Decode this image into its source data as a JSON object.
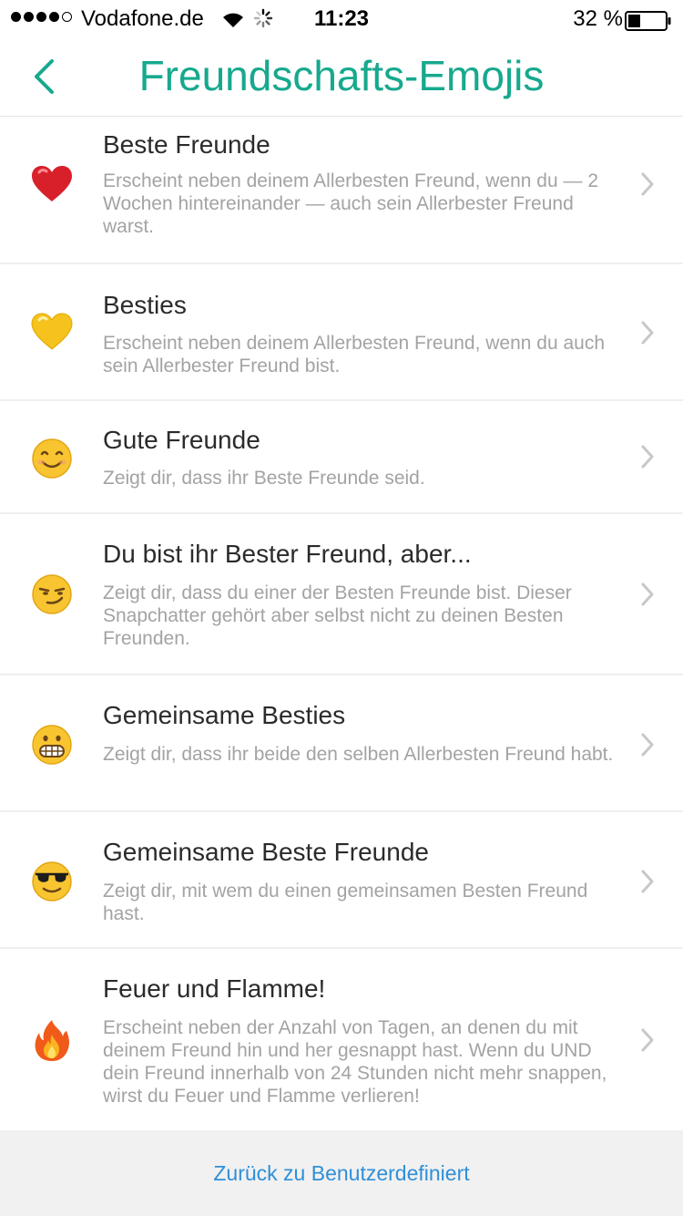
{
  "status_bar": {
    "carrier": "Vodafone.de",
    "time": "11:23",
    "battery": "32 %",
    "signal_bars_filled": 4,
    "signal_bars_total": 5
  },
  "nav": {
    "title": "Freundschafts-Emojis",
    "back_icon": "chevron-left-icon",
    "accent_color": "#16a98e"
  },
  "items": [
    {
      "emoji_name": "red-heart",
      "title": "Beste Freunde",
      "description": "Erscheint neben deinem Allerbesten Freund, wenn du — 2 Wochen hintereinander — auch sein Allerbester Freund warst."
    },
    {
      "emoji_name": "yellow-heart",
      "title": "Besties",
      "description": "Erscheint neben deinem Allerbesten Freund, wenn du auch sein Allerbester Freund bist."
    },
    {
      "emoji_name": "smiling-face",
      "title": "Gute Freunde",
      "description": "Zeigt dir, dass ihr Beste Freunde seid."
    },
    {
      "emoji_name": "smirking-face",
      "title": "Du bist ihr Bester Freund, aber...",
      "description": "Zeigt dir, dass du einer der Besten Freunde bist. Dieser Snapchatter gehört aber selbst nicht zu deinen Besten Freunden."
    },
    {
      "emoji_name": "grimacing-face",
      "title": "Gemeinsame Besties",
      "description": "Zeigt dir, dass ihr beide den selben Allerbesten Freund habt."
    },
    {
      "emoji_name": "sunglasses-face",
      "title": "Gemeinsame Beste Freunde",
      "description": "Zeigt dir, mit wem du einen gemeinsamen Besten Freund hast."
    },
    {
      "emoji_name": "fire",
      "title": "Feuer und Flamme!",
      "description": "Erscheint neben der Anzahl von Tagen, an denen du mit deinem Freund hin und her gesnappt hast. Wenn du UND dein Freund innerhalb von 24 Stunden nicht mehr snappen, wirst du Feuer und Flamme verlieren!"
    }
  ],
  "bottom": {
    "link_label": "Zurück zu Benutzerdefiniert",
    "link_color": "#2f8fd8"
  }
}
